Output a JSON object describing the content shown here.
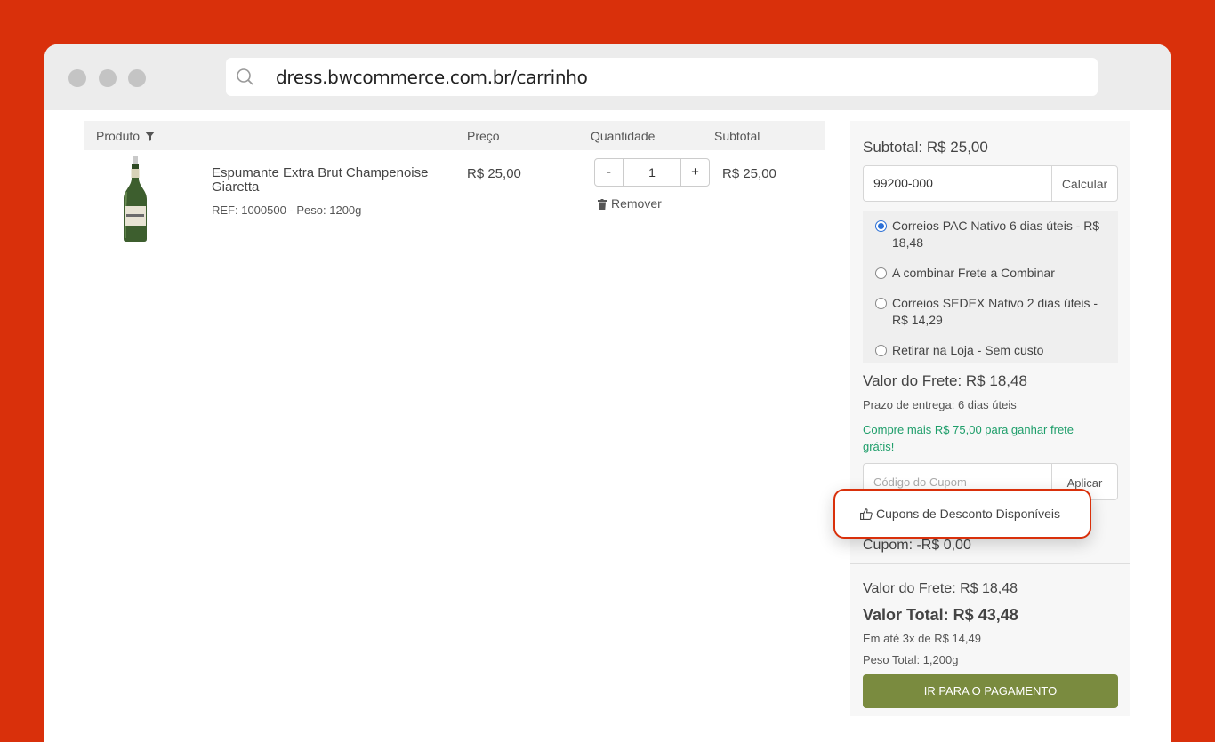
{
  "browser": {
    "url": "dress.bwcommerce.com.br/carrinho"
  },
  "cart": {
    "headers": {
      "produto": "Produto",
      "preco": "Preço",
      "quantidade": "Quantidade",
      "subtotal": "Subtotal"
    },
    "item": {
      "name": "Espumante Extra Brut Champenoise Giaretta",
      "ref": "REF: 1000500 - Peso: 1200g",
      "price": "R$ 25,00",
      "qty_minus": "-",
      "qty_value": "1",
      "qty_plus": "+",
      "remove_label": "Remover",
      "subtotal": "R$ 25,00"
    }
  },
  "summary": {
    "subtotal": "Subtotal: R$ 25,00",
    "cep_value": "99200-000",
    "calc_label": "Calcular",
    "shipping_options": [
      {
        "label": "Correios PAC Nativo 6 dias úteis - R$ 18,48",
        "selected": true
      },
      {
        "label": "A combinar Frete a Combinar",
        "selected": false
      },
      {
        "label": "Correios SEDEX Nativo 2 dias úteis - R$ 14,29",
        "selected": false
      },
      {
        "label": "Retirar na Loja - Sem custo",
        "selected": false
      }
    ],
    "frete_value": "Valor do Frete: R$ 18,48",
    "prazo": "Prazo de entrega: 6 dias úteis",
    "promo": "Compre mais R$ 75,00 para ganhar frete grátis!",
    "coupon_placeholder": "Código do Cupom",
    "apply_label": "Aplicar",
    "coupon_value": "Cupom: -R$ 0,00",
    "frete_value_2": "Valor do Frete: R$ 18,48",
    "total": "Valor Total:  R$ 43,48",
    "installments": "Em até 3x de R$ 14,49",
    "peso": "Peso Total: 1,200g",
    "pay_label": "IR PARA O PAGAMENTO"
  },
  "popup": {
    "label": "Cupons de Desconto Disponíveis"
  },
  "colors": {
    "background": "#d9300b",
    "pay_button": "#7a8b3f",
    "promo_text": "#1e9e6a",
    "radio_selected": "#2a6fd6"
  }
}
